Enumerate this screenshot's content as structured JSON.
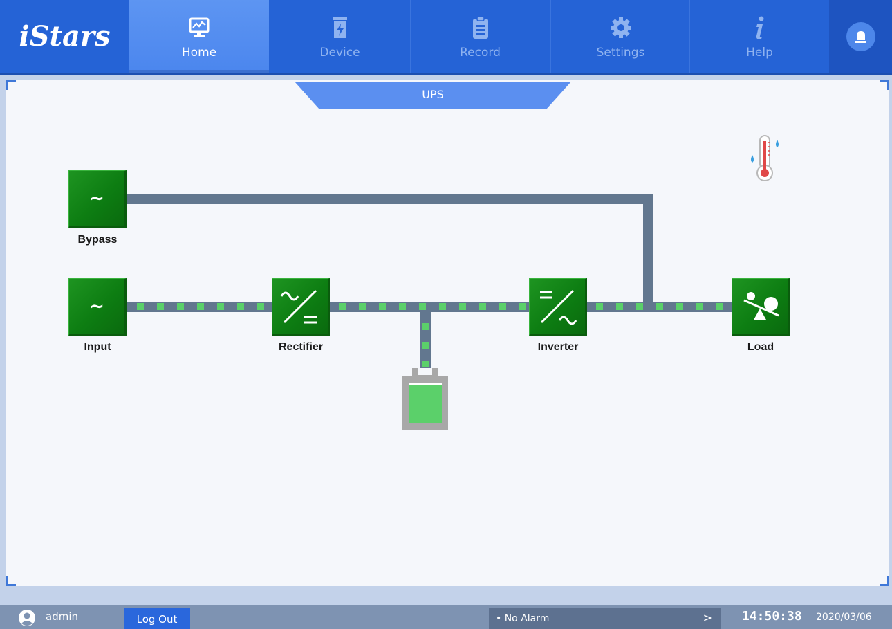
{
  "app": {
    "logo_text": "iStars"
  },
  "nav": {
    "tabs": [
      {
        "label": "Home",
        "icon": "monitor-chart-icon",
        "active": true
      },
      {
        "label": "Device",
        "icon": "battery-device-icon",
        "active": false
      },
      {
        "label": "Record",
        "icon": "clipboard-icon",
        "active": false
      },
      {
        "label": "Settings",
        "icon": "gear-icon",
        "active": false
      },
      {
        "label": "Help",
        "icon": "info-icon",
        "active": false
      }
    ],
    "alarm_icon": "alarm-bell-icon"
  },
  "panel": {
    "title": "UPS"
  },
  "diagram": {
    "modules": [
      {
        "id": "bypass",
        "label": "Bypass",
        "symbol": "∼"
      },
      {
        "id": "input",
        "label": "Input",
        "symbol": "∼"
      },
      {
        "id": "rectifier",
        "label": "Rectifier",
        "icon": "ac-dc-icon"
      },
      {
        "id": "inverter",
        "label": "Inverter",
        "icon": "dc-ac-icon"
      },
      {
        "id": "load",
        "label": "Load",
        "icon": "load-seesaw-icon"
      }
    ],
    "battery_icon": "battery-icon",
    "environment_icon": "temperature-humidity-icon"
  },
  "status": {
    "user": "admin",
    "logout_label": "Log Out",
    "alarm_text": "• No Alarm",
    "alarm_arrow": ">",
    "time": "14:50:38",
    "date": "2020/03/06"
  },
  "colors": {
    "header": "#2563d6",
    "active_tab": "#5d95f2",
    "module_green": "#0d7d12",
    "bus": "#62778f",
    "flow_dot": "#5bd06a",
    "statusbar": "#7e93b2"
  }
}
